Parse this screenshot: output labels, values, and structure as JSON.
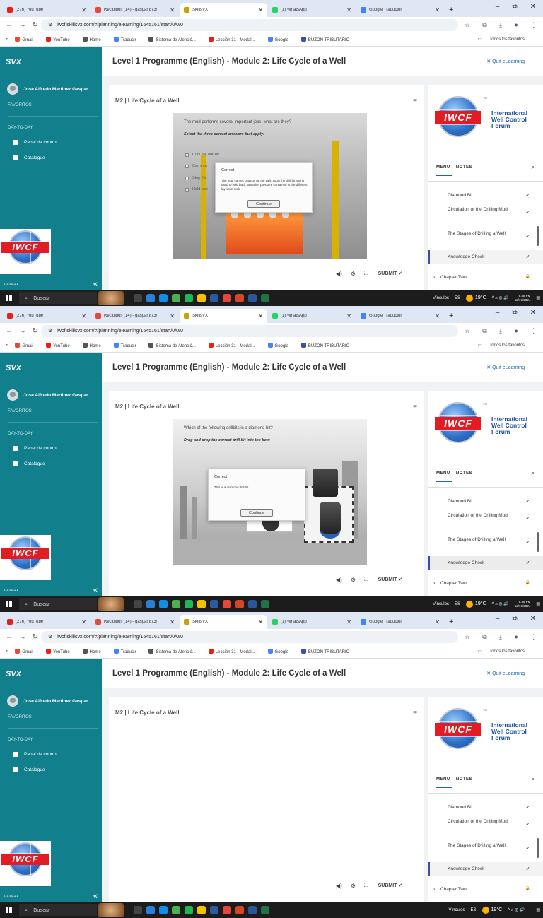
{
  "browser": {
    "tabs": [
      {
        "label": "(276) YouTube",
        "color": "#e62117"
      },
      {
        "label": "Recibidos (14) - gaspar.873!",
        "color": "#e6493a"
      },
      {
        "label": "SkillsVX",
        "color": "#c9a300"
      },
      {
        "label": "(1) WhatsApp",
        "color": "#25d366"
      },
      {
        "label": "Google Traductor",
        "color": "#4285f4"
      }
    ],
    "new_tab": "+",
    "win_minimize": "–",
    "win_restore": "⧉",
    "win_close": "✕",
    "url": "iwcf.skillsvx.com/#/planning/elearning/1645161/start/0/0/0",
    "bookmarks": [
      {
        "label": "Gmail",
        "color": "#e6493a"
      },
      {
        "label": "YouTube",
        "color": "#e62117"
      },
      {
        "label": "Home",
        "color": "#555555"
      },
      {
        "label": "Traducir",
        "color": "#4285f4"
      },
      {
        "label": "Sistema de Atenció...",
        "color": "#555555"
      },
      {
        "label": "Lección 31 - Modal...",
        "color": "#e62117"
      },
      {
        "label": "Google",
        "color": "#4285f4"
      },
      {
        "label": "BUZÓN TRIBUTARIO",
        "color": "#3a4fa8"
      }
    ],
    "all_bookmarks": "Todos los favoritos"
  },
  "sidebar": {
    "logo": "SVX",
    "user_name": "Jose Alfredo Martinez Gaspar",
    "favorites": "FAVORITOS",
    "day_to_day": "DAY-TO-DAY",
    "items": [
      {
        "label": "Panel de control"
      },
      {
        "label": "Catalogue"
      }
    ],
    "version": "v10.50.1.1",
    "collapse": "«",
    "emblem_text": "IWCF"
  },
  "header": {
    "title": "Level 1 Programme (English) - Module 2: Life Cycle of a Well",
    "quit": "Quit eLearning",
    "quit_icon": "✕"
  },
  "lesson": {
    "title": "M2 | Life Cycle of a Well",
    "menu_icon": "≡"
  },
  "screens": [
    {
      "question": "The mud performs several important jobs, what are they?",
      "instruction": "Select the three correct answers that apply:",
      "options": [
        "Cool the drill bit",
        "Carry cu",
        "Stop the",
        "Hold bac"
      ],
      "dialog_title": "Correct",
      "dialog_message": "The mud carries cuttings up the well, cools the drill bit and is used to hold back formation pressure contained in the different layers of rock.",
      "dialog_button": "Continue",
      "clock_time": "8:48 PM",
      "clock_date": "12/17/2024"
    },
    {
      "question": "Which of the following drillbits is a diamond bit?",
      "instruction": "Drag and drop the correct drill bit into the box:",
      "dialog_title": "Correct",
      "dialog_message": "This is a diamond drill bit.",
      "dialog_button": "Continue",
      "clock_time": "8:49 PM",
      "clock_date": "12/17/2024"
    },
    {}
  ],
  "controls": {
    "submit": "SUBMIT",
    "submit_icon": "✓"
  },
  "right_panel": {
    "brand_line1": "International",
    "brand_line2": "Well Control",
    "brand_line3": "Forum",
    "trademark": "TM",
    "emblem": "IWCF",
    "tab_menu": "MENU",
    "tab_notes": "NOTES",
    "search_icon": "⌕",
    "items": [
      {
        "label": "Diamond Bit",
        "check": "✓"
      },
      {
        "label": "Circulation of the Drilling Mud",
        "check": "✓"
      },
      {
        "label": "The Stages of Drilling a Well",
        "check": "✓"
      },
      {
        "label": "Knowledge Check",
        "check": "✓"
      },
      {
        "label": "Chapter Two",
        "check": "🔒"
      }
    ],
    "chapter_caret": "›"
  },
  "taskbar": {
    "search": "Buscar",
    "links": "Vínculos",
    "lang": "ES",
    "temp": "19°C",
    "tray": "^ ⌂ ◎ 🔊"
  }
}
